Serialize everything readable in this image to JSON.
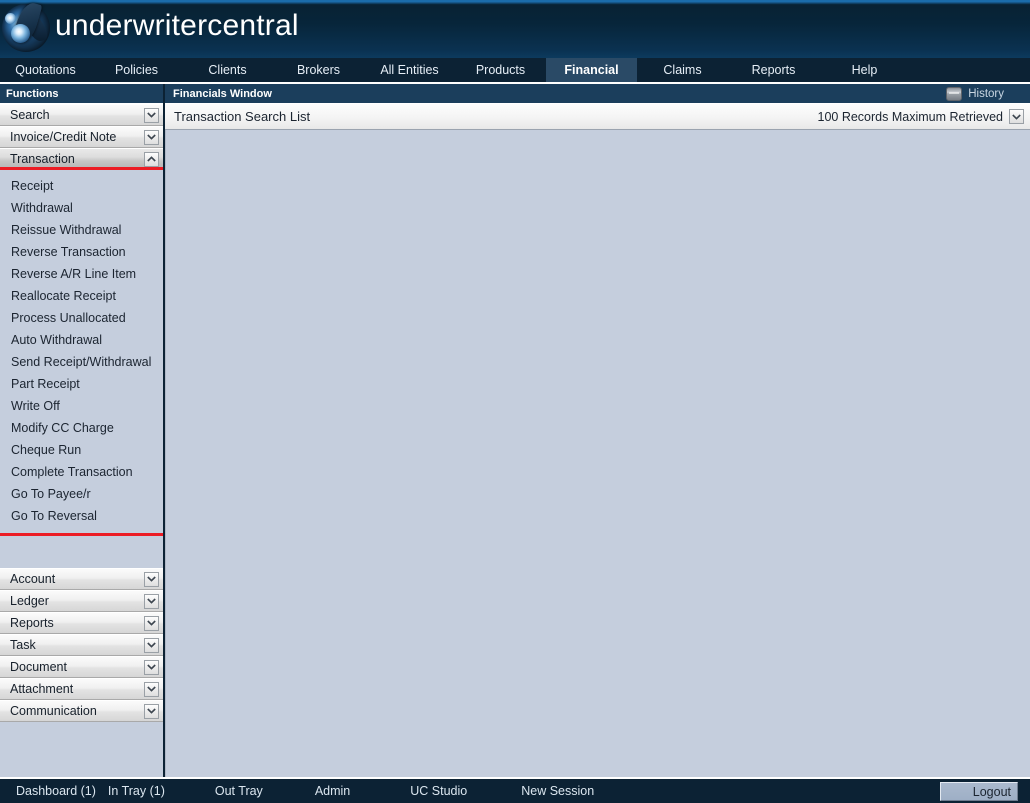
{
  "brand": {
    "title": "underwritercentral",
    "logo_icon": "swirl-logo-icon"
  },
  "nav": {
    "tabs": [
      {
        "label": "Quotations",
        "active": false
      },
      {
        "label": "Policies",
        "active": false
      },
      {
        "label": "Clients",
        "active": false
      },
      {
        "label": "Brokers",
        "active": false
      },
      {
        "label": "All Entities",
        "active": false
      },
      {
        "label": "Products",
        "active": false
      },
      {
        "label": "Financial",
        "active": true
      },
      {
        "label": "Claims",
        "active": false
      },
      {
        "label": "Reports",
        "active": false
      },
      {
        "label": "Help",
        "active": false
      }
    ]
  },
  "sidebar": {
    "title": "Functions",
    "sections": [
      {
        "label": "Search",
        "expanded": false,
        "chevron": "chevron-down-icon"
      },
      {
        "label": "Invoice/Credit Note",
        "expanded": false,
        "chevron": "chevron-down-icon"
      },
      {
        "label": "Transaction",
        "expanded": true,
        "highlighted": true,
        "chevron": "chevron-up-icon",
        "items": [
          "Receipt",
          "Withdrawal",
          "Reissue Withdrawal",
          "Reverse Transaction",
          "Reverse A/R Line Item",
          "Reallocate Receipt",
          "Process Unallocated",
          "Auto Withdrawal",
          "Send Receipt/Withdrawal",
          "Part Receipt",
          "Write Off",
          "Modify CC Charge",
          "Cheque Run",
          "Complete Transaction",
          "Go To Payee/r",
          "Go To Reversal"
        ]
      },
      {
        "label": "Account",
        "expanded": false,
        "chevron": "chevron-down-icon"
      },
      {
        "label": "Ledger",
        "expanded": false,
        "chevron": "chevron-down-icon"
      },
      {
        "label": "Reports",
        "expanded": false,
        "chevron": "chevron-down-icon"
      },
      {
        "label": "Task",
        "expanded": false,
        "chevron": "chevron-down-icon"
      },
      {
        "label": "Document",
        "expanded": false,
        "chevron": "chevron-down-icon"
      },
      {
        "label": "Attachment",
        "expanded": false,
        "chevron": "chevron-down-icon"
      },
      {
        "label": "Communication",
        "expanded": false,
        "chevron": "chevron-down-icon"
      }
    ]
  },
  "content": {
    "window_title": "Financials Window",
    "history_label": "History",
    "history_icon": "history-box-icon",
    "subbar_title": "Transaction Search List",
    "records_label": "100 Records Maximum Retrieved",
    "records_chevron": "chevron-down-icon"
  },
  "bottom": {
    "items": [
      "Dashboard (1)",
      "In Tray (1)",
      "Out Tray",
      "Admin",
      "UC Studio",
      "New Session"
    ],
    "logout_label": "Logout"
  },
  "colors": {
    "header_navy": "#07253a",
    "nav_bar": "#0c2234",
    "active_tab": "#2a4a66",
    "panel_bg": "#c5cedd",
    "title_bar": "#1b3e5c",
    "highlight_red": "#ec1c24"
  }
}
